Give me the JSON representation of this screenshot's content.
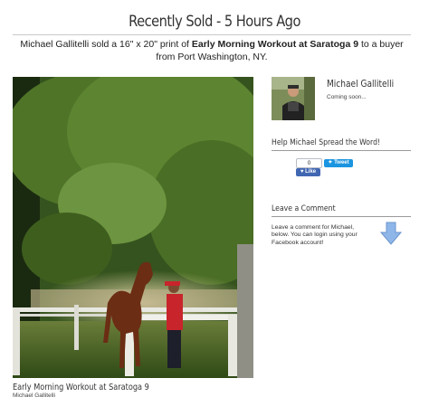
{
  "page": {
    "title": "Recently Sold - 5 Hours Ago",
    "sold_prefix": "Michael Gallitelli sold a 16\" x 20\" print of ",
    "artwork_title": "Early Morning Workout at Saratoga 9",
    "sold_suffix": " to a buyer from Port Washington, NY."
  },
  "artwork": {
    "title": "Early Morning Workout at Saratoga 9",
    "artist": "Michael Gallitelli"
  },
  "artist_panel": {
    "name": "Michael Gallitelli",
    "bio": "Coming soon..."
  },
  "share": {
    "heading": "Help Michael Spread the Word!",
    "like_count": "0",
    "like_label": "Like",
    "tweet_label": "Tweet"
  },
  "comment": {
    "heading": "Leave a Comment",
    "text": "Leave a comment for Michael, below.   You can login using your Facebook account!"
  },
  "colors": {
    "facebook": "#4267b2",
    "twitter": "#1b95e0",
    "arrow": "#8fb6e8"
  },
  "icons": {
    "fb": "facebook-like-icon",
    "tw": "twitter-bird-icon",
    "arrow": "down-arrow-icon"
  }
}
